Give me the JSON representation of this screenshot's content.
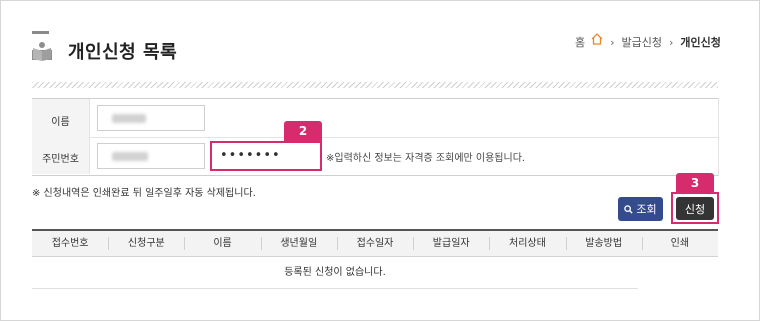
{
  "page": {
    "title": "개인신청 목록"
  },
  "breadcrumb": {
    "home": "홈",
    "level1": "발급신청",
    "current": "개인신청"
  },
  "form": {
    "name_label": "이름",
    "id_label": "주민번호",
    "password_value": "•••••••",
    "password_hint": "※입력하신 정보는 자격증 조회에만 이용됩니다."
  },
  "steps": {
    "step2": "2",
    "step3": "3"
  },
  "notice": "※ 신청내역은 인쇄완료 뒤 일주일후 자동 삭제됩니다.",
  "buttons": {
    "search": "조회",
    "apply": "신청"
  },
  "table": {
    "headers": [
      "접수번호",
      "신청구분",
      "이름",
      "생년월일",
      "접수일자",
      "발급일자",
      "처리상태",
      "발송방법",
      "인쇄"
    ],
    "empty_message": "등록된 신청이 없습니다."
  },
  "colors": {
    "highlight": "#d62c6e",
    "search_button": "#344b8c",
    "apply_button": "#343434"
  },
  "icons": {
    "title": "book-icon",
    "home": "home-icon",
    "search": "search-icon"
  }
}
